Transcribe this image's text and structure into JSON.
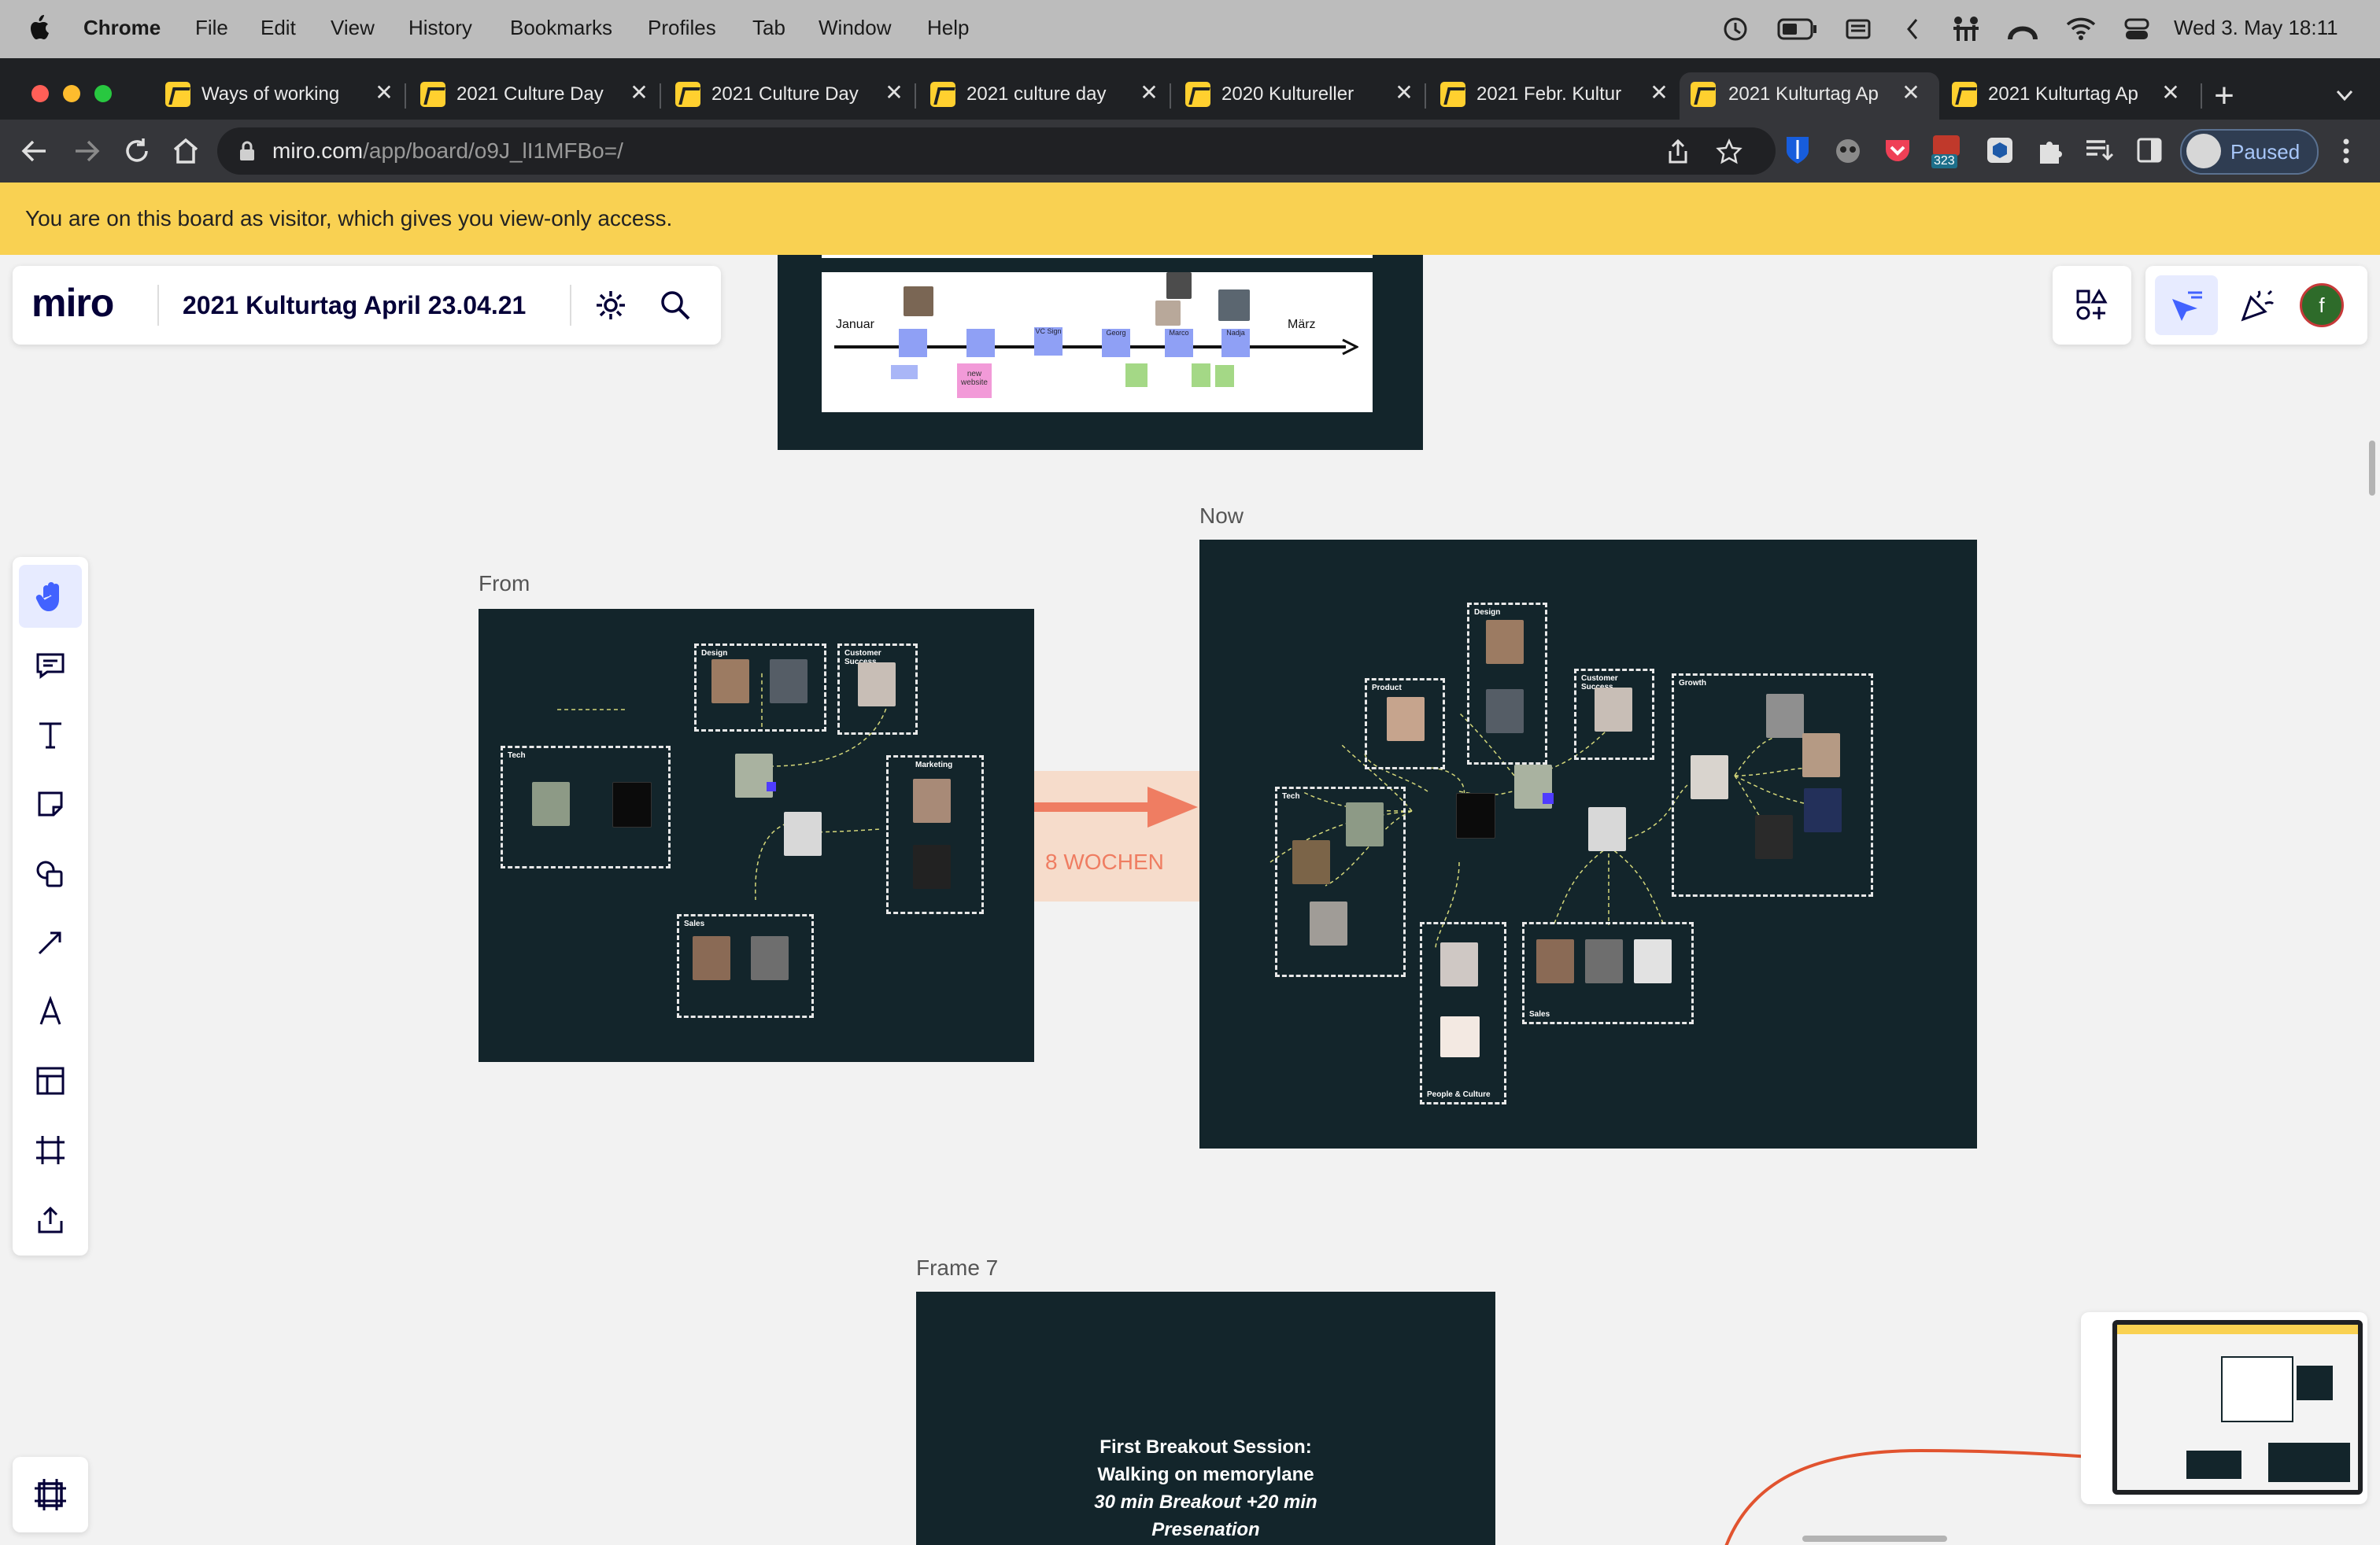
{
  "menubar": {
    "app": "Chrome",
    "items": [
      "File",
      "Edit",
      "View",
      "History",
      "Bookmarks",
      "Profiles",
      "Tab",
      "Window",
      "Help"
    ],
    "clock": "Wed 3. May  18:11"
  },
  "tabs": [
    {
      "title": "Ways of working"
    },
    {
      "title": "2021 Culture Day"
    },
    {
      "title": "2021 Culture Day"
    },
    {
      "title": "2021 culture day"
    },
    {
      "title": "2020 Kultureller"
    },
    {
      "title": "2021 Febr. Kultur"
    },
    {
      "title": "2021 Kulturtag Ap",
      "active": true
    },
    {
      "title": "2021 Kulturtag Ap"
    }
  ],
  "browser": {
    "url_host": "miro.com",
    "url_path": "/app/board/o9J_lI1MFBo=/",
    "profile_status": "Paused",
    "ext_badge": "323"
  },
  "banner": {
    "text": "You are on this board as visitor, which gives you view-only access."
  },
  "miro": {
    "logo": "miro",
    "board_title": "2021 Kulturtag April 23.04.21",
    "user_initial": "f"
  },
  "timeline": {
    "start": "Januar",
    "end": "März",
    "labels": [
      "VC Sign",
      "Georg",
      "Marco",
      "Nadja"
    ],
    "pink_note": "new website"
  },
  "frames": {
    "from": "From",
    "now": "Now",
    "frame7": "Frame 7",
    "arrow_label": "8 WOCHEN"
  },
  "from_groups": {
    "tech": "Tech",
    "design": "Design",
    "customer_success": "Customer Success",
    "marketing": "Marketing",
    "sales": "Sales"
  },
  "now_groups": {
    "product": "Product",
    "design": "Design",
    "customer_success": "Customer Success",
    "growth": "Growth",
    "tech": "Tech",
    "sales": "Sales",
    "people_culture": "People & Culture"
  },
  "frame7_text": {
    "line1": "First Breakout Session:",
    "line2": "Walking on memorylane",
    "line3": "30 min Breakout +20 min",
    "line4": "Presenation"
  },
  "colors": {
    "frame_bg": "#13252b",
    "banner": "#f9d152",
    "arrow": "#ef7d62",
    "arrow_bg": "#f6dccb",
    "accent": "#4262ff",
    "curve": "#e1532f"
  }
}
